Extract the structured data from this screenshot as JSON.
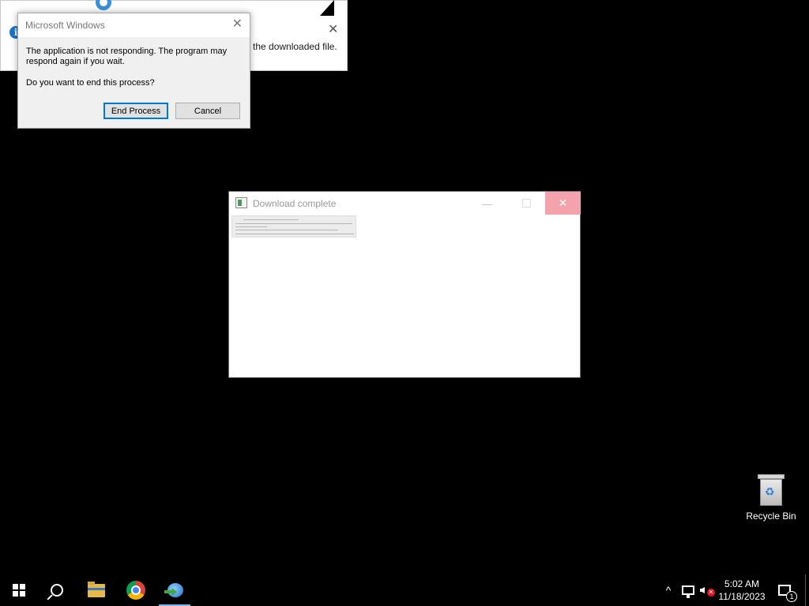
{
  "balloon": {
    "text": "the downloaded file.",
    "info_glyph": "i",
    "close_glyph": "✕"
  },
  "dialog": {
    "title": "Microsoft Windows",
    "close_glyph": "✕",
    "message": "The application is not responding. The program may respond again if you wait.",
    "question": "Do you want to end this process?",
    "end_process_label": "End Process",
    "cancel_label": "Cancel"
  },
  "download_window": {
    "title": "Download complete",
    "minimize_glyph": "—",
    "close_glyph": "✕"
  },
  "desktop": {
    "recycle_bin_label": "Recycle Bin"
  },
  "taskbar": {
    "pinned": [
      "start",
      "search",
      "file-explorer",
      "chrome",
      "internet-download-manager"
    ],
    "active": "internet-download-manager",
    "tray_chevron": "^",
    "time": "5:02 AM",
    "date": "11/18/2023",
    "notification_count": "1"
  },
  "colors": {
    "accent": "#0078d7",
    "close_hover": "#f4a3ad",
    "taskbar": "#000000"
  }
}
